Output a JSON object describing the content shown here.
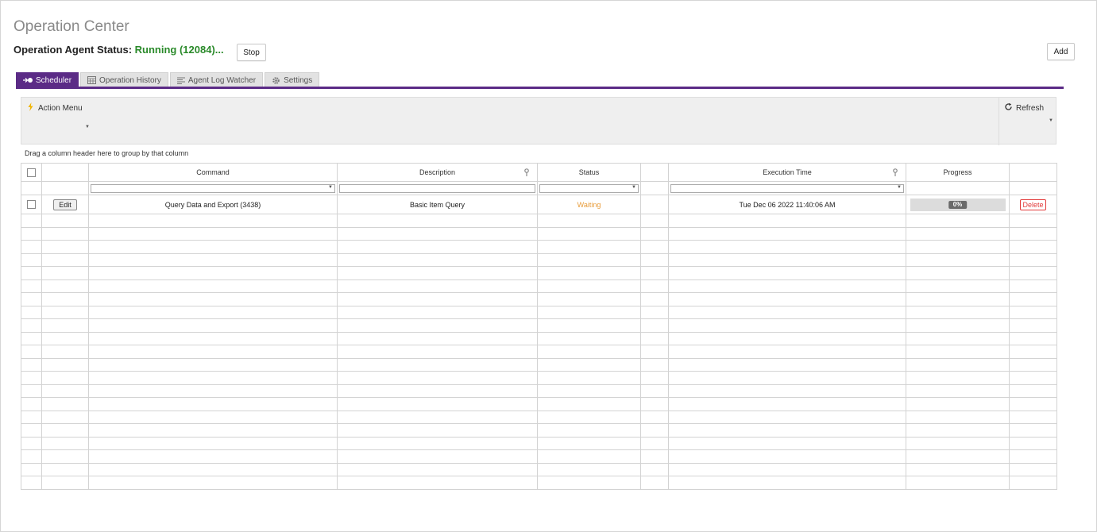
{
  "header": {
    "title": "Operation Center",
    "agent_status_label": "Operation Agent Status:",
    "agent_status_value": "Running (12084)...",
    "stop_label": "Stop",
    "add_label": "Add"
  },
  "tabs": [
    {
      "label": "Scheduler",
      "icon": "scheduler-icon",
      "active": true
    },
    {
      "label": "Operation History",
      "icon": "calendar-icon",
      "active": false
    },
    {
      "label": "Agent Log Watcher",
      "icon": "list-icon",
      "active": false
    },
    {
      "label": "Settings",
      "icon": "gear-icon",
      "active": false
    }
  ],
  "toolbar": {
    "action_menu_label": "Action Menu",
    "refresh_label": "Refresh",
    "group_hint": "Drag a column header here to group by that column"
  },
  "grid": {
    "columns": [
      "",
      "",
      "Command",
      "Description",
      "Status",
      "",
      "Execution Time",
      "Progress",
      ""
    ],
    "rows": [
      {
        "edit_label": "Edit",
        "command": "Query Data and Export (3438)",
        "description": "Basic Item Query",
        "status": "Waiting",
        "execution_time": "Tue Dec 06 2022 11:40:06 AM",
        "progress_label": "0%",
        "progress": 0,
        "delete_label": "Delete"
      }
    ]
  },
  "colors": {
    "accent": "#5b2b86",
    "running": "#2a8a2a",
    "waiting": "#e89c3a",
    "delete": "#e23b3b"
  }
}
